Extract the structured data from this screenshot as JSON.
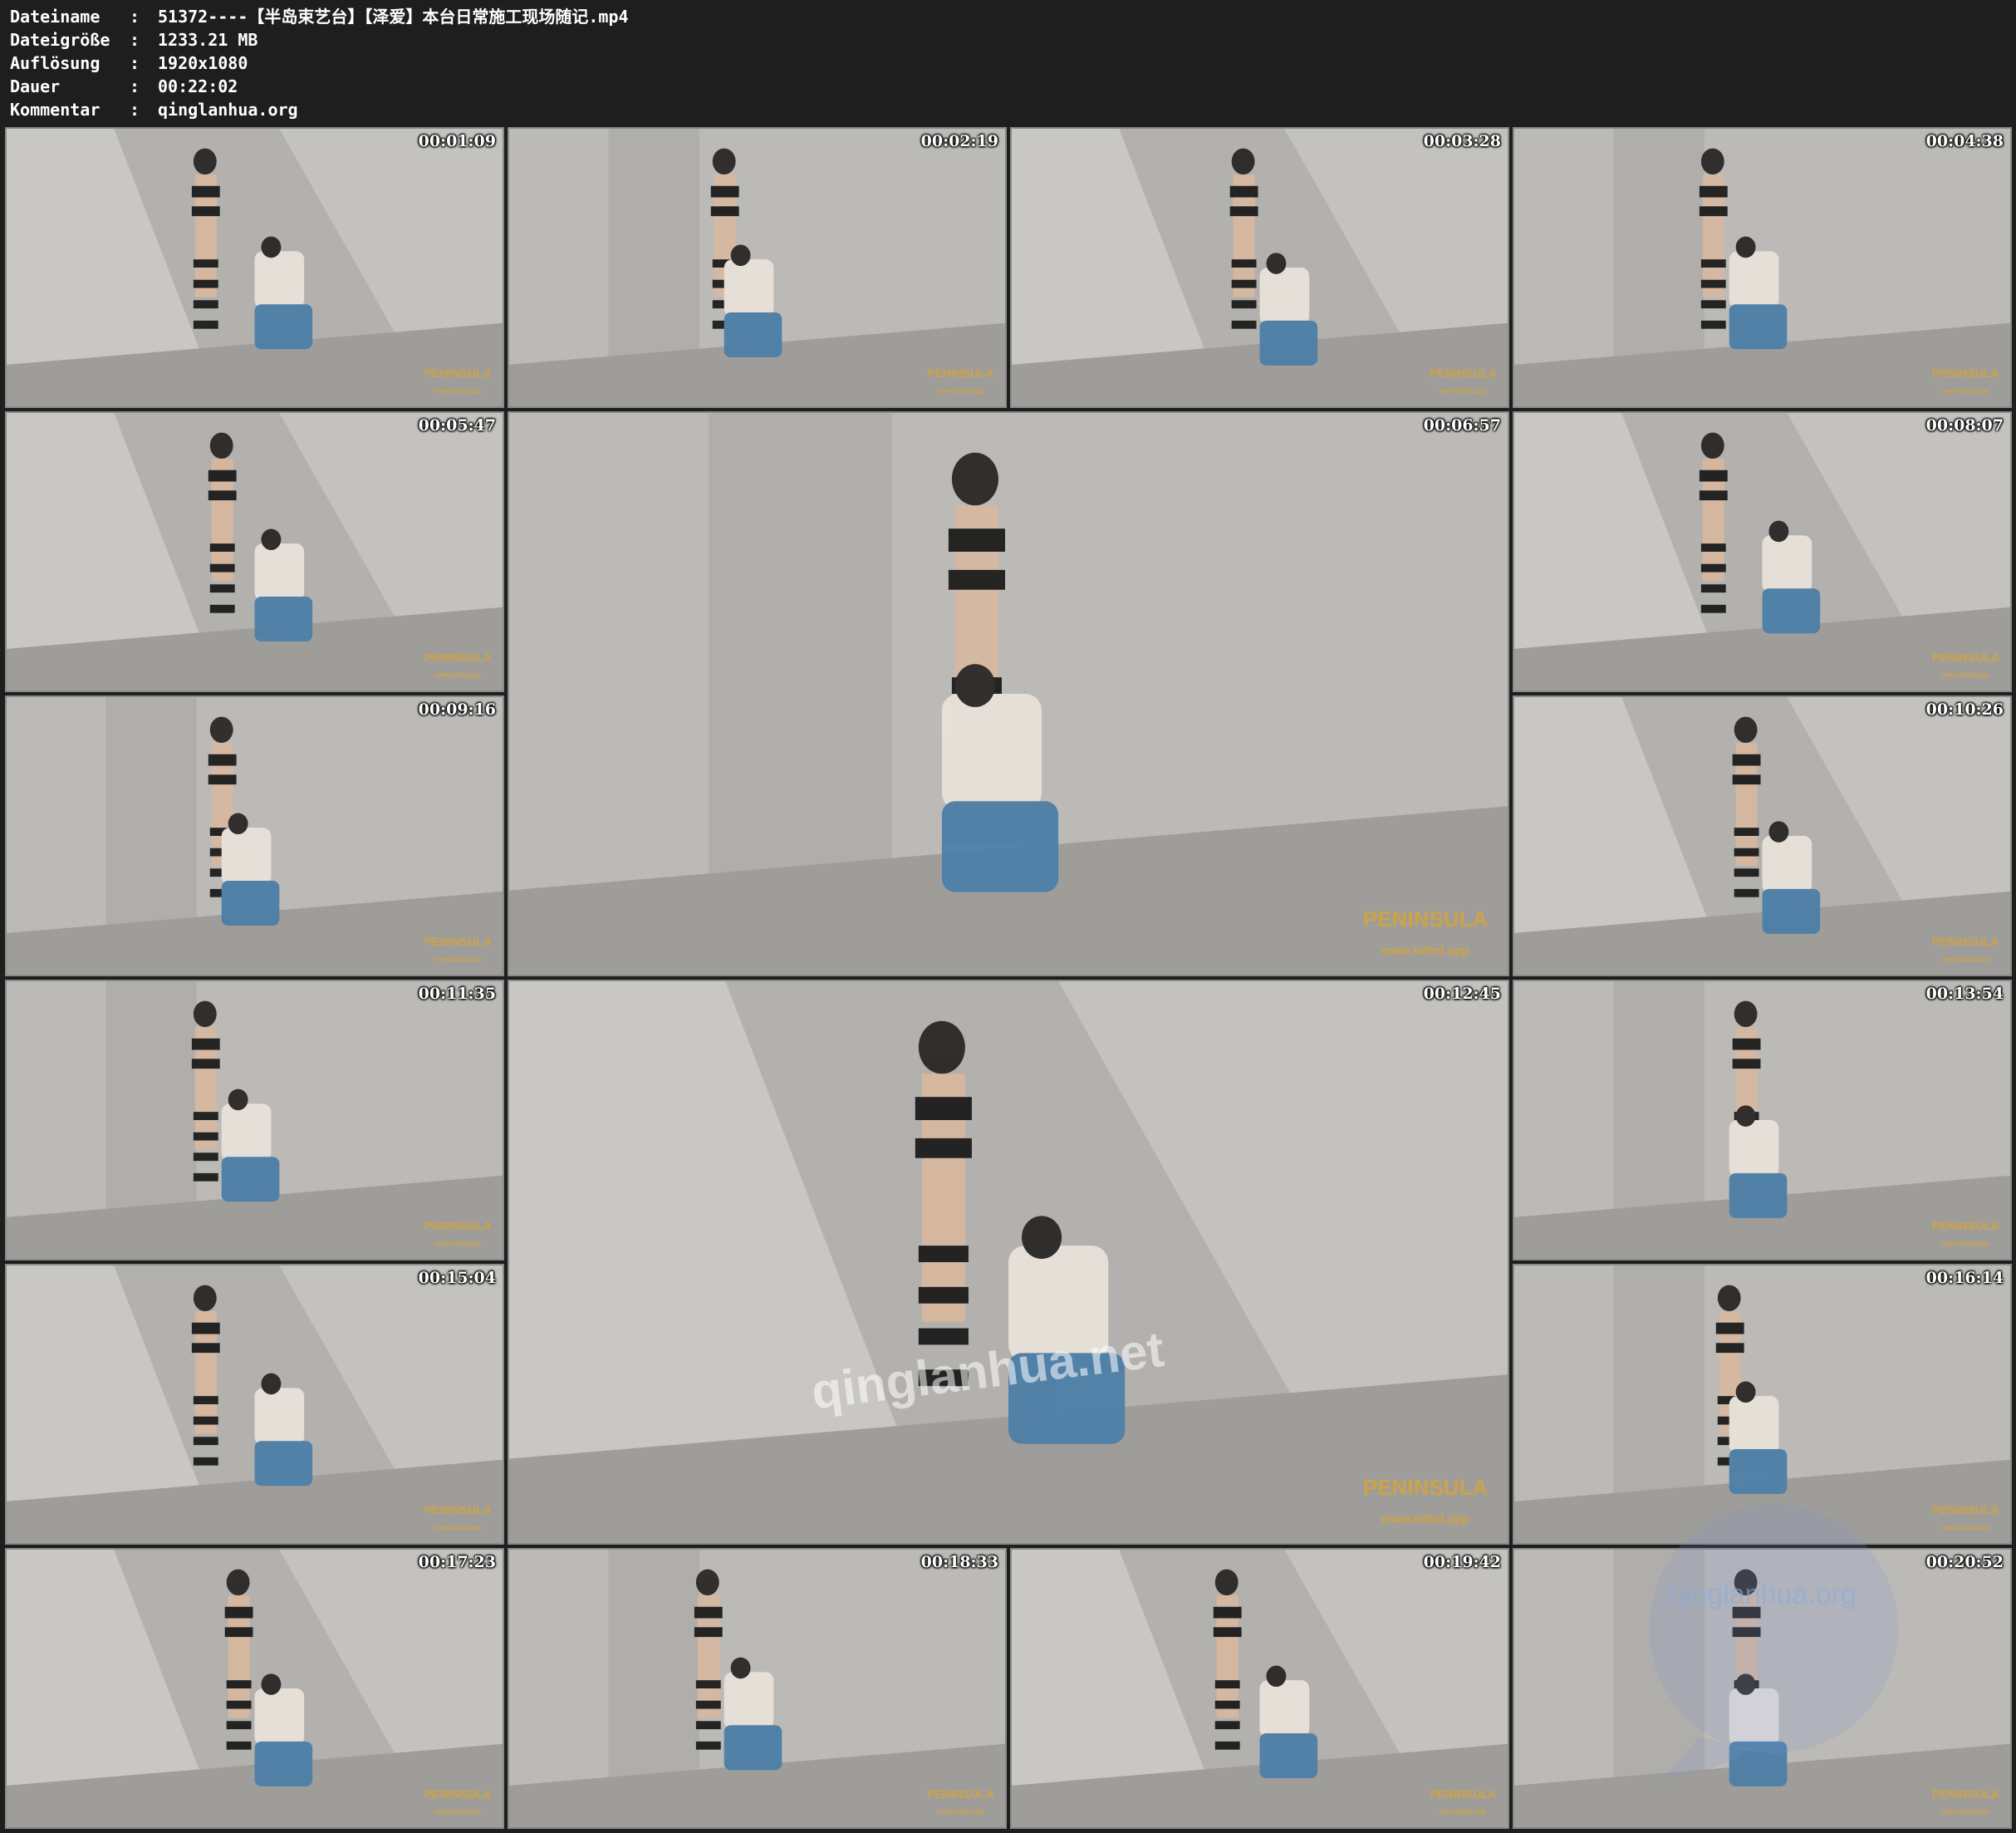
{
  "header": {
    "rows": [
      {
        "label": "Dateiname",
        "sep": ":",
        "value": "51372----【半岛束艺台】【泽爱】本台日常施工现场随记.mp4"
      },
      {
        "label": "Dateigröße",
        "sep": ":",
        "value": "1233.21 MB"
      },
      {
        "label": "Auflösung",
        "sep": ":",
        "value": "1920x1080"
      },
      {
        "label": "Dauer",
        "sep": ":",
        "value": "00:22:02"
      },
      {
        "label": "Kommentar",
        "sep": ":",
        "value": "qinglanhua.org"
      }
    ]
  },
  "logo": {
    "name": "PENINSULA",
    "url": "www.bdbd.app"
  },
  "watermarks": {
    "center": "qinglanhua.net",
    "corner": "qinglanhua.org"
  },
  "thumbnails": [
    {
      "timestamp": "00:01:09"
    },
    {
      "timestamp": "00:02:19"
    },
    {
      "timestamp": "00:03:28"
    },
    {
      "timestamp": "00:04:38"
    },
    {
      "timestamp": "00:05:47"
    },
    {
      "timestamp": "00:06:57"
    },
    {
      "timestamp": "00:08:07"
    },
    {
      "timestamp": "00:09:16"
    },
    {
      "timestamp": "00:10:26"
    },
    {
      "timestamp": "00:11:35"
    },
    {
      "timestamp": "00:12:45"
    },
    {
      "timestamp": "00:13:54"
    },
    {
      "timestamp": "00:15:04"
    },
    {
      "timestamp": "00:16:14"
    },
    {
      "timestamp": "00:17:23"
    },
    {
      "timestamp": "00:18:33"
    },
    {
      "timestamp": "00:19:42"
    },
    {
      "timestamp": "00:20:52"
    }
  ]
}
